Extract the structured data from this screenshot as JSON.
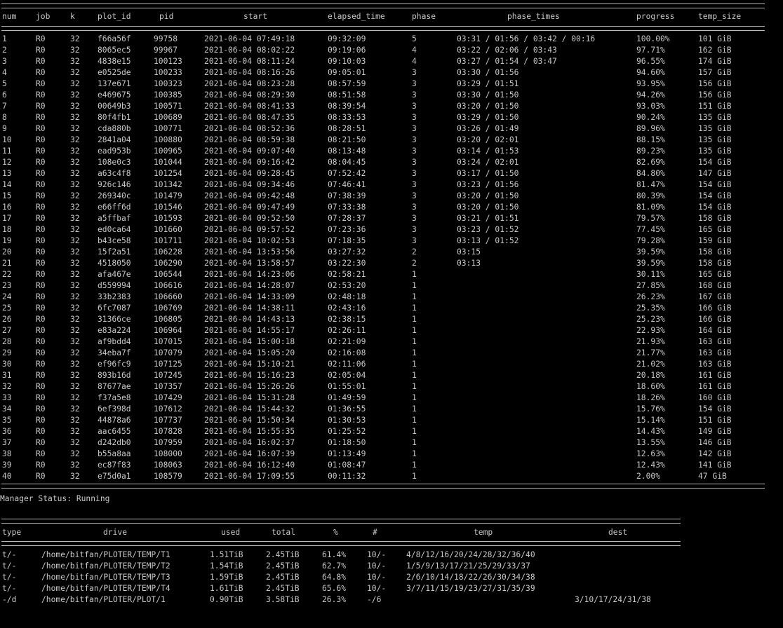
{
  "plots": {
    "columns": {
      "num": "num",
      "job": "job",
      "k": "k",
      "plot_id": "plot_id",
      "pid": "pid",
      "start": "start",
      "elapsed_time": "elapsed_time",
      "phase": "phase",
      "phase_times": "phase_times",
      "progress": "progress",
      "temp_size": "temp_size"
    },
    "rows": [
      [
        "1",
        "R0",
        "32",
        "f66a56f",
        "99758",
        "2021-06-04 07:49:18",
        "09:32:09",
        "5",
        "03:31 / 01:56 / 03:42 / 00:16",
        "100.00%",
        "101 GiB"
      ],
      [
        "2",
        "R0",
        "32",
        "8065ec5",
        "99967",
        "2021-06-04 08:02:22",
        "09:19:06",
        "4",
        "03:22 / 02:06 / 03:43",
        "97.71%",
        "162 GiB"
      ],
      [
        "3",
        "R0",
        "32",
        "4838e15",
        "100123",
        "2021-06-04 08:11:24",
        "09:10:03",
        "4",
        "03:27 / 01:54 / 03:47",
        "96.55%",
        "174 GiB"
      ],
      [
        "4",
        "R0",
        "32",
        "e0525de",
        "100233",
        "2021-06-04 08:16:26",
        "09:05:01",
        "3",
        "03:30 / 01:56",
        "94.60%",
        "157 GiB"
      ],
      [
        "5",
        "R0",
        "32",
        "137e671",
        "100323",
        "2021-06-04 08:23:28",
        "08:57:59",
        "3",
        "03:29 / 01:51",
        "93.95%",
        "156 GiB"
      ],
      [
        "6",
        "R0",
        "32",
        "e469675",
        "100385",
        "2021-06-04 08:29:30",
        "08:51:58",
        "3",
        "03:30 / 01:50",
        "94.26%",
        "156 GiB"
      ],
      [
        "7",
        "R0",
        "32",
        "00649b3",
        "100571",
        "2021-06-04 08:41:33",
        "08:39:54",
        "3",
        "03:20 / 01:50",
        "93.03%",
        "151 GiB"
      ],
      [
        "8",
        "R0",
        "32",
        "80f4fb1",
        "100689",
        "2021-06-04 08:47:35",
        "08:33:53",
        "3",
        "03:29 / 01:50",
        "90.24%",
        "135 GiB"
      ],
      [
        "9",
        "R0",
        "32",
        "cda880b",
        "100771",
        "2021-06-04 08:52:36",
        "08:28:51",
        "3",
        "03:26 / 01:49",
        "89.96%",
        "135 GiB"
      ],
      [
        "10",
        "R0",
        "32",
        "2841a04",
        "100880",
        "2021-06-04 08:59:38",
        "08:21:50",
        "3",
        "03:20 / 02:01",
        "88.15%",
        "135 GiB"
      ],
      [
        "11",
        "R0",
        "32",
        "ead953b",
        "100965",
        "2021-06-04 09:07:40",
        "08:13:48",
        "3",
        "03:14 / 01:53",
        "89.23%",
        "135 GiB"
      ],
      [
        "12",
        "R0",
        "32",
        "108e0c3",
        "101044",
        "2021-06-04 09:16:42",
        "08:04:45",
        "3",
        "03:24 / 02:01",
        "82.69%",
        "154 GiB"
      ],
      [
        "13",
        "R0",
        "32",
        "a63c4f8",
        "101254",
        "2021-06-04 09:28:45",
        "07:52:42",
        "3",
        "03:17 / 01:50",
        "84.80%",
        "147 GiB"
      ],
      [
        "14",
        "R0",
        "32",
        "926c146",
        "101342",
        "2021-06-04 09:34:46",
        "07:46:41",
        "3",
        "03:23 / 01:56",
        "81.47%",
        "154 GiB"
      ],
      [
        "15",
        "R0",
        "32",
        "269340c",
        "101479",
        "2021-06-04 09:42:48",
        "07:38:39",
        "3",
        "03:20 / 01:50",
        "80.39%",
        "154 GiB"
      ],
      [
        "16",
        "R0",
        "32",
        "e66ff6d",
        "101546",
        "2021-06-04 09:47:49",
        "07:33:38",
        "3",
        "03:20 / 01:50",
        "81.09%",
        "154 GiB"
      ],
      [
        "17",
        "R0",
        "32",
        "a5ffbaf",
        "101593",
        "2021-06-04 09:52:50",
        "07:28:37",
        "3",
        "03:21 / 01:51",
        "79.57%",
        "158 GiB"
      ],
      [
        "18",
        "R0",
        "32",
        "ed0ca64",
        "101660",
        "2021-06-04 09:57:52",
        "07:23:36",
        "3",
        "03:23 / 01:52",
        "77.45%",
        "165 GiB"
      ],
      [
        "19",
        "R0",
        "32",
        "b43ce58",
        "101711",
        "2021-06-04 10:02:53",
        "07:18:35",
        "3",
        "03:13 / 01:52",
        "79.28%",
        "159 GiB"
      ],
      [
        "20",
        "R0",
        "32",
        "15f2a51",
        "106228",
        "2021-06-04 13:53:56",
        "03:27:32",
        "2",
        "03:15",
        "39.59%",
        "158 GiB"
      ],
      [
        "21",
        "R0",
        "32",
        "4518050",
        "106290",
        "2021-06-04 13:58:57",
        "03:22:30",
        "2",
        "03:13",
        "39.59%",
        "158 GiB"
      ],
      [
        "22",
        "R0",
        "32",
        "afa467e",
        "106544",
        "2021-06-04 14:23:06",
        "02:58:21",
        "1",
        "",
        "30.11%",
        "165 GiB"
      ],
      [
        "23",
        "R0",
        "32",
        "d559994",
        "106616",
        "2021-06-04 14:28:07",
        "02:53:20",
        "1",
        "",
        "27.85%",
        "168 GiB"
      ],
      [
        "24",
        "R0",
        "32",
        "33b2383",
        "106660",
        "2021-06-04 14:33:09",
        "02:48:18",
        "1",
        "",
        "26.23%",
        "167 GiB"
      ],
      [
        "25",
        "R0",
        "32",
        "6fc7087",
        "106769",
        "2021-06-04 14:38:11",
        "02:43:16",
        "1",
        "",
        "25.35%",
        "166 GiB"
      ],
      [
        "26",
        "R0",
        "32",
        "31366ce",
        "106805",
        "2021-06-04 14:43:13",
        "02:38:15",
        "1",
        "",
        "25.23%",
        "166 GiB"
      ],
      [
        "27",
        "R0",
        "32",
        "e83a224",
        "106964",
        "2021-06-04 14:55:17",
        "02:26:11",
        "1",
        "",
        "22.93%",
        "164 GiB"
      ],
      [
        "28",
        "R0",
        "32",
        "af9bdd4",
        "107015",
        "2021-06-04 15:00:18",
        "02:21:09",
        "1",
        "",
        "21.93%",
        "163 GiB"
      ],
      [
        "29",
        "R0",
        "32",
        "34eba7f",
        "107079",
        "2021-06-04 15:05:20",
        "02:16:08",
        "1",
        "",
        "21.77%",
        "163 GiB"
      ],
      [
        "30",
        "R0",
        "32",
        "ef96fc9",
        "107125",
        "2021-06-04 15:10:21",
        "02:11:06",
        "1",
        "",
        "21.02%",
        "163 GiB"
      ],
      [
        "31",
        "R0",
        "32",
        "893b16d",
        "107245",
        "2021-06-04 15:16:23",
        "02:05:04",
        "1",
        "",
        "20.18%",
        "161 GiB"
      ],
      [
        "32",
        "R0",
        "32",
        "87677ae",
        "107357",
        "2021-06-04 15:26:26",
        "01:55:01",
        "1",
        "",
        "18.60%",
        "161 GiB"
      ],
      [
        "33",
        "R0",
        "32",
        "f37a5e8",
        "107429",
        "2021-06-04 15:31:28",
        "01:49:59",
        "1",
        "",
        "18.26%",
        "160 GiB"
      ],
      [
        "34",
        "R0",
        "32",
        "6ef398d",
        "107612",
        "2021-06-04 15:44:32",
        "01:36:55",
        "1",
        "",
        "15.76%",
        "154 GiB"
      ],
      [
        "35",
        "R0",
        "32",
        "44878a6",
        "107737",
        "2021-06-04 15:50:34",
        "01:30:53",
        "1",
        "",
        "15.14%",
        "151 GiB"
      ],
      [
        "36",
        "R0",
        "32",
        "aac6455",
        "107828",
        "2021-06-04 15:55:35",
        "01:25:52",
        "1",
        "",
        "14.43%",
        "149 GiB"
      ],
      [
        "37",
        "R0",
        "32",
        "d242db0",
        "107959",
        "2021-06-04 16:02:37",
        "01:18:50",
        "1",
        "",
        "13.55%",
        "146 GiB"
      ],
      [
        "38",
        "R0",
        "32",
        "b55a8aa",
        "108000",
        "2021-06-04 16:07:39",
        "01:13:49",
        "1",
        "",
        "12.63%",
        "142 GiB"
      ],
      [
        "39",
        "R0",
        "32",
        "ec87f83",
        "108063",
        "2021-06-04 16:12:40",
        "01:08:47",
        "1",
        "",
        "12.43%",
        "141 GiB"
      ],
      [
        "40",
        "R0",
        "32",
        "e75d0a1",
        "108579",
        "2021-06-04 17:09:55",
        "00:11:32",
        "1",
        "",
        "2.00%",
        "47 GiB"
      ]
    ]
  },
  "manager_status": "Manager Status: Running",
  "drives": {
    "columns": {
      "type": "type",
      "drive": "drive",
      "used": "used",
      "total": "total",
      "percent": "%",
      "count": "#",
      "temp": "temp",
      "dest": "dest"
    },
    "rows": [
      [
        "t/-",
        "/home/bitfan/PLOTER/TEMP/T1",
        "1.51TiB",
        "2.45TiB",
        "61.4%",
        "10/-",
        "4/8/12/16/20/24/28/32/36/40",
        ""
      ],
      [
        "t/-",
        "/home/bitfan/PLOTER/TEMP/T2",
        "1.54TiB",
        "2.45TiB",
        "62.7%",
        "10/-",
        "1/5/9/13/17/21/25/29/33/37",
        ""
      ],
      [
        "t/-",
        "/home/bitfan/PLOTER/TEMP/T3",
        "1.59TiB",
        "2.45TiB",
        "64.8%",
        "10/-",
        "2/6/10/14/18/22/26/30/34/38",
        ""
      ],
      [
        "t/-",
        "/home/bitfan/PLOTER/TEMP/T4",
        "1.61TiB",
        "2.45TiB",
        "65.6%",
        "10/-",
        "3/7/11/15/19/23/27/31/35/39",
        ""
      ],
      [
        "-/d",
        "/home/bitfan/PLOTER/PLOT/1",
        "0.90TiB",
        "3.58TiB",
        "26.3%",
        "-/6",
        "",
        "3/10/17/24/31/38"
      ]
    ]
  }
}
